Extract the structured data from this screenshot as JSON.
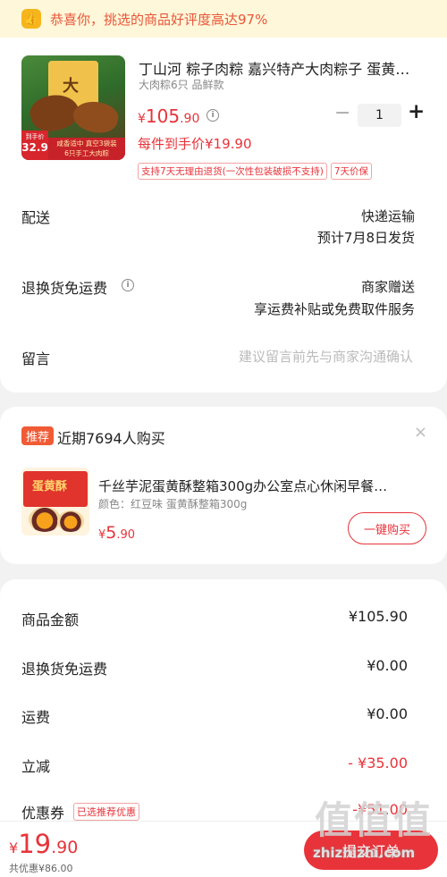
{
  "banner": {
    "icon": "thumbs-up-icon",
    "text": "恭喜你，挑选的商品好评度高达97%"
  },
  "product": {
    "title": "丁山河 粽子肉粽 嘉兴特产大肉粽子 蛋黄…",
    "variant": "大肉粽6只 品鲜款",
    "image_texts": {
      "brand_char": "大",
      "tag_top": "到手价",
      "tag_price": "32.9",
      "promo_line1": "咸香适中 真空3袋装",
      "promo_line2": "6只手工大肉粽"
    },
    "price_symbol": "¥",
    "price_int": "105",
    "price_dec": ".90",
    "quantity": "1",
    "minus_label": "−",
    "plus_label": "+",
    "unit_price": "每件到手价¥19.90",
    "tags": [
      "支持7天无理由退货(一次性包装破损不支持)",
      "7天价保"
    ]
  },
  "delivery": {
    "label": "配送",
    "method": "快递运输",
    "eta": "预计7月8日发货"
  },
  "return_shipping": {
    "label": "退换货免运费",
    "line1": "商家赠送",
    "line2": "享运费补贴或免费取件服务"
  },
  "message": {
    "label": "留言",
    "placeholder": "建议留言前先与商家沟通确认"
  },
  "recommend": {
    "badge": "推荐",
    "title": "近期7694人购买",
    "close_label": "×",
    "item_name": "千丝芋泥蛋黄酥整箱300g办公室点心休闲早餐…",
    "item_variant": "颜色：红豆味 蛋黄酥整箱300g",
    "image_text": "蛋黄酥",
    "price_symbol": "¥",
    "price_int": "5",
    "price_dec": ".90",
    "buy_label": "一键购买"
  },
  "summary": {
    "rows": [
      {
        "label": "商品金额",
        "value": "¥105.90"
      },
      {
        "label": "退换货免运费",
        "value": "¥0.00"
      },
      {
        "label": "运费",
        "value": "¥0.00"
      },
      {
        "label": "立减",
        "value": "- ¥35.00"
      },
      {
        "label": "优惠券",
        "value": "-¥51.00"
      }
    ],
    "coupon_chip": "已选推荐优惠"
  },
  "footer": {
    "total_symbol": "¥",
    "total_int": "19",
    "total_dec": ".90",
    "saving": "共优惠¥86.00",
    "submit_label": "提交订单"
  },
  "watermark": {
    "line1": "值值值",
    "line2": "zhizhizhi.com"
  },
  "colors": {
    "accent": "#e8333a",
    "banner_bg": "#fff7d9",
    "badge_orange": "#f05b36"
  }
}
